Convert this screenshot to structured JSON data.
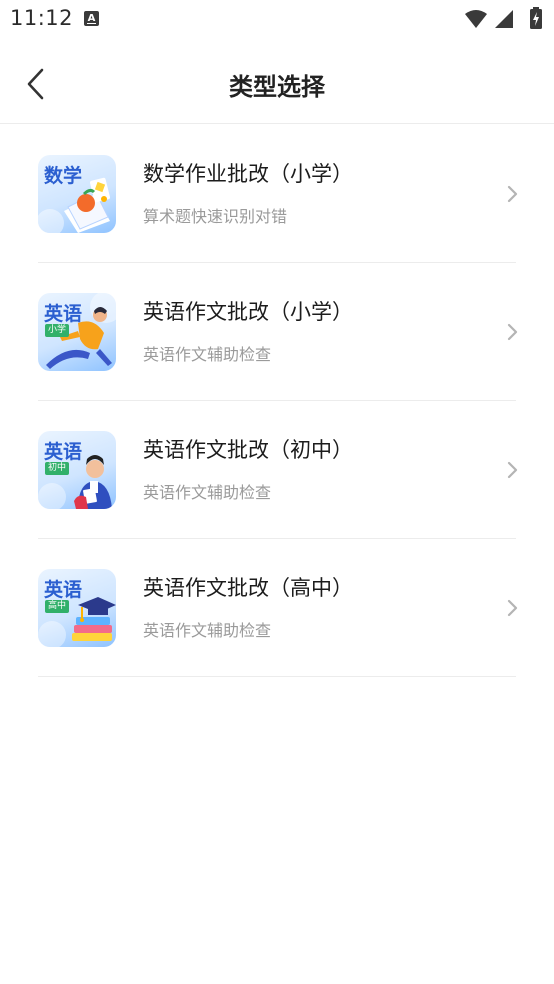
{
  "status_bar": {
    "time": "11:12"
  },
  "header": {
    "title": "类型选择"
  },
  "items": [
    {
      "icon_title": "数学",
      "icon_tag": "",
      "title": "数学作业批改（小学）",
      "subtitle": "算术题快速识别对错"
    },
    {
      "icon_title": "英语",
      "icon_tag": "小学",
      "title": "英语作文批改（小学）",
      "subtitle": "英语作文辅助检查"
    },
    {
      "icon_title": "英语",
      "icon_tag": "初中",
      "title": "英语作文批改（初中）",
      "subtitle": "英语作文辅助检查"
    },
    {
      "icon_title": "英语",
      "icon_tag": "高中",
      "title": "英语作文批改（高中）",
      "subtitle": "英语作文辅助检查"
    }
  ],
  "icons": {
    "status_notification": "a-notification-icon",
    "wifi": "wifi-icon",
    "signal": "signal-icon",
    "battery": "battery-charging-icon",
    "back": "back-arrow-icon",
    "chevron": "chevron-right-icon"
  }
}
